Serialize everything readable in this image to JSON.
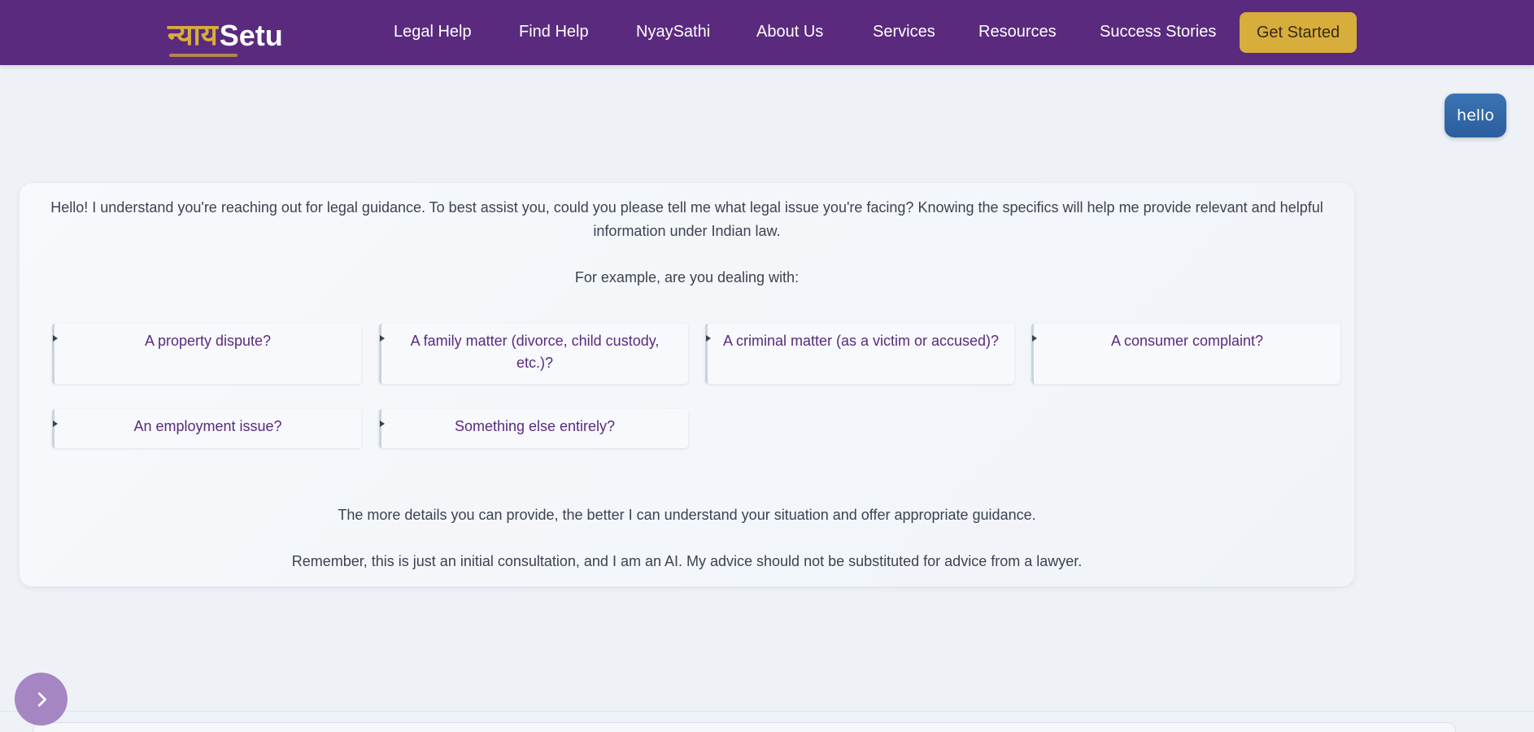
{
  "header": {
    "logo_hindi": "न्याय",
    "logo_en": "Setu",
    "nav": [
      "Legal Help",
      "Find Help",
      "NyaySathi",
      "About Us",
      "Services",
      "Resources",
      "Success Stories"
    ],
    "cta_label": "Get Started",
    "colors": {
      "bar": "#5a2a7e",
      "accent": "#d7ad3c"
    }
  },
  "chat": {
    "user_message": "hello",
    "bot": {
      "intro": "Hello! I understand you're reaching out for legal guidance. To best assist you, could you please tell me what legal issue you're facing? Knowing the specifics will help me provide relevant and helpful information under Indian law.",
      "example_prompt": "For example, are you dealing with:",
      "options": [
        "A property dispute?",
        "A family matter (divorce, child custody, etc.)?",
        "A criminal matter (as a victim or accused)?",
        "A consumer complaint?",
        "An employment issue?",
        "Something else entirely?"
      ],
      "details_note": "The more details you can provide, the better I can understand your situation and offer appropriate guidance.",
      "disclaimer": "Remember, this is just an initial consultation, and I am an AI. My advice should not be substituted for advice from a lawyer."
    }
  },
  "sidebar_toggle": {
    "icon": "chevron-right-icon"
  }
}
